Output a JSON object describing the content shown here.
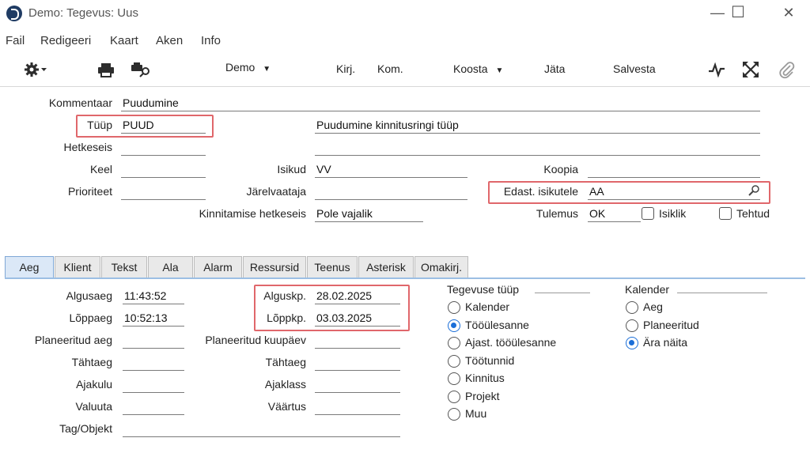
{
  "window": {
    "title": "Demo: Tegevus: Uus",
    "minimize": "—",
    "maximize": "☐",
    "close": "✕"
  },
  "menu": {
    "items": [
      "Fail",
      "Redigeeri",
      "Kaart",
      "Aken",
      "Info"
    ]
  },
  "toolbar": {
    "gear_icon": "gear-icon",
    "demo_label": "Demo",
    "kirj_label": "Kirj.",
    "kom_label": "Kom.",
    "koosta_label": "Koosta",
    "jata_label": "Jäta",
    "salvesta_label": "Salvesta",
    "print_icon": "print-icon",
    "print_preview_icon": "print-preview-icon",
    "activity_icon": "pulse-icon",
    "fullscreen_icon": "expand-icon",
    "attach_icon": "paperclip-icon"
  },
  "header": {
    "kommentaar_label": "Kommentaar",
    "kommentaar_value": "Puudumine",
    "tuup_label": "Tüüp",
    "tuup_value": "PUUD",
    "tuup_description": "Puudumine kinnitusringi tüüp",
    "hetkeseis_label": "Hetkeseis",
    "hetkeseis_value": "",
    "keel_label": "Keel",
    "keel_value": "",
    "isikud_label": "Isikud",
    "isikud_value": "VV",
    "koopia_label": "Koopia",
    "koopia_value": "",
    "prioriteet_label": "Prioriteet",
    "prioriteet_value": "",
    "jarelvaataja_label": "Järelvaataja",
    "jarelvaataja_value": "",
    "edast_label": "Edast. isikutele",
    "edast_value": "AA",
    "kinnitamise_label": "Kinnitamise hetkeseis",
    "kinnitamise_value": "Pole vajalik",
    "tulemus_label": "Tulemus",
    "tulemus_value": "OK",
    "isiklik_label": "Isiklik",
    "isiklik_checked": false,
    "tehtud_label": "Tehtud",
    "tehtud_checked": false
  },
  "tabs": [
    "Aeg",
    "Klient",
    "Tekst",
    "Ala",
    "Alarm",
    "Ressursid",
    "Teenus",
    "Asterisk",
    "Omakirj."
  ],
  "active_tab": "Aeg",
  "aeg": {
    "algusaeg_label": "Algusaeg",
    "algusaeg_value": "11:43:52",
    "loppaeg_label": "Lõppaeg",
    "loppaeg_value": "10:52:13",
    "alguskp_label": "Alguskp.",
    "alguskp_value": "28.02.2025",
    "loppkp_label": "Lõppkp.",
    "loppkp_value": "03.03.2025",
    "planeeritud_aeg_label": "Planeeritud aeg",
    "planeeritud_aeg_value": "",
    "planeeritud_kuupaev_label": "Planeeritud kuupäev",
    "planeeritud_kuupaev_value": "",
    "tahtaeg_label": "Tähtaeg",
    "tahtaeg_value": "",
    "tahtaeg2_label": "Tähtaeg",
    "tahtaeg2_value": "",
    "ajakulu_label": "Ajakulu",
    "ajakulu_value": "",
    "ajaklass_label": "Ajaklass",
    "ajaklass_value": "",
    "valuuta_label": "Valuuta",
    "valuuta_value": "",
    "vaartus_label": "Väärtus",
    "vaartus_value": "",
    "tag_label": "Tag/Objekt",
    "tag_value": ""
  },
  "tegevuse_tuup": {
    "title": "Tegevuse tüüp",
    "options": [
      "Kalender",
      "Tööülesanne",
      "Ajast. tööülesanne",
      "Töötunnid",
      "Kinnitus",
      "Projekt",
      "Muu"
    ],
    "selected": "Tööülesanne"
  },
  "kalender": {
    "title": "Kalender",
    "options": [
      "Aeg",
      "Planeeritud",
      "Ära näita"
    ],
    "selected": "Ära näita"
  },
  "colors": {
    "highlight": "#e0676b",
    "radio_selected": "#1a6ed8",
    "active_tab": "#dbe8f7"
  }
}
